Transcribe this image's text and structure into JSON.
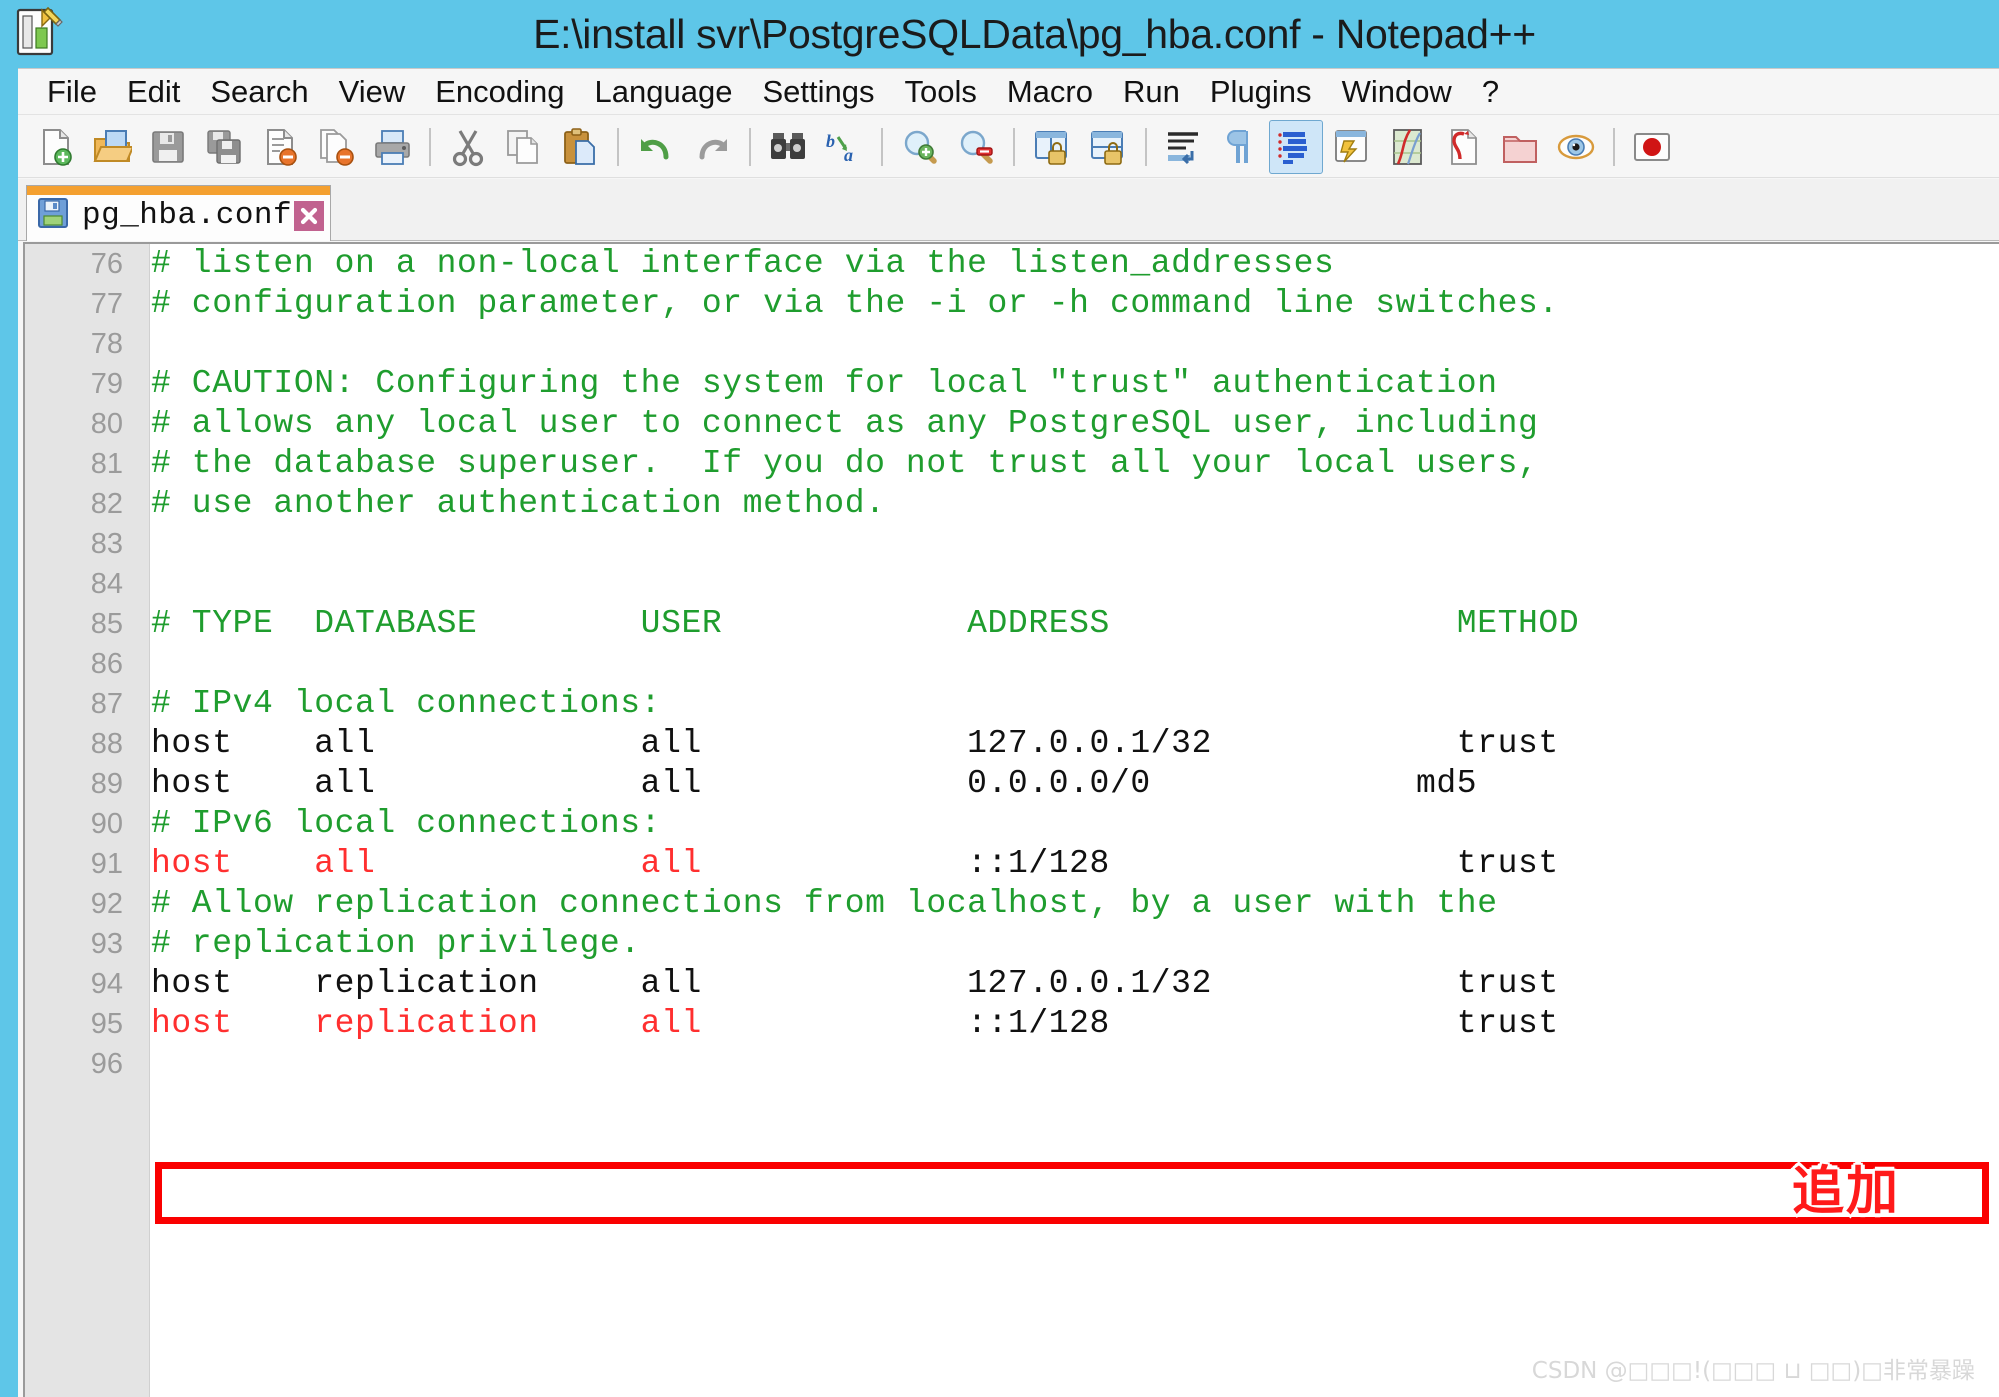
{
  "window": {
    "title": "E:\\install svr\\PostgreSQLData\\pg_hba.conf - Notepad++",
    "app_icon": "notepadpp-pencil-icon",
    "title_bar_color": "#5ec6e8"
  },
  "menubar": {
    "items": [
      {
        "label": "File",
        "name": "menu-file"
      },
      {
        "label": "Edit",
        "name": "menu-edit"
      },
      {
        "label": "Search",
        "name": "menu-search"
      },
      {
        "label": "View",
        "name": "menu-view"
      },
      {
        "label": "Encoding",
        "name": "menu-encoding"
      },
      {
        "label": "Language",
        "name": "menu-language"
      },
      {
        "label": "Settings",
        "name": "menu-settings"
      },
      {
        "label": "Tools",
        "name": "menu-tools"
      },
      {
        "label": "Macro",
        "name": "menu-macro"
      },
      {
        "label": "Run",
        "name": "menu-run"
      },
      {
        "label": "Plugins",
        "name": "menu-plugins"
      },
      {
        "label": "Window",
        "name": "menu-window"
      },
      {
        "label": "?",
        "name": "menu-help"
      }
    ]
  },
  "toolbar": {
    "icons": [
      "new-file-icon",
      "open-file-icon",
      "save-icon",
      "save-all-icon",
      "close-file-icon",
      "close-all-icon",
      "print-icon",
      "SEP",
      "cut-icon",
      "copy-icon",
      "paste-icon",
      "SEP",
      "undo-icon",
      "redo-icon",
      "SEP",
      "find-icon",
      "replace-icon",
      "SEP",
      "zoom-in-icon",
      "zoom-out-icon",
      "SEP",
      "sync-vertical-scroll-icon",
      "sync-horizontal-scroll-icon",
      "SEP",
      "word-wrap-icon",
      "show-all-characters-icon",
      "indent-guide-icon",
      "user-defined-language-icon",
      "document-map-icon",
      "function-list-icon",
      "folder-as-workspace-icon",
      "monitoring-icon",
      "SEP",
      "record-macro-icon"
    ],
    "active_icon": "indent-guide-icon"
  },
  "tabs": [
    {
      "label": "pg_hba.conf",
      "icon": "save-blue-icon",
      "close": "close-tab-icon",
      "active": true
    }
  ],
  "editor": {
    "first_line": 76,
    "lines": [
      {
        "n": 76,
        "segments": [
          {
            "t": "# listen on a non-local interface via the listen_addresses",
            "c": "comment"
          }
        ]
      },
      {
        "n": 77,
        "segments": [
          {
            "t": "# configuration parameter, or via the -i or -h command line switches.",
            "c": "comment"
          }
        ]
      },
      {
        "n": 78,
        "segments": [
          {
            "t": "",
            "c": "black"
          }
        ]
      },
      {
        "n": 79,
        "segments": [
          {
            "t": "# CAUTION: Configuring the system for local \"trust\" authentication",
            "c": "comment"
          }
        ]
      },
      {
        "n": 80,
        "segments": [
          {
            "t": "# allows any local user to connect as any PostgreSQL user, including",
            "c": "comment"
          }
        ]
      },
      {
        "n": 81,
        "segments": [
          {
            "t": "# the database superuser.  If you do not trust all your local users,",
            "c": "comment"
          }
        ]
      },
      {
        "n": 82,
        "segments": [
          {
            "t": "# use another authentication method.",
            "c": "comment"
          }
        ]
      },
      {
        "n": 83,
        "segments": [
          {
            "t": "",
            "c": "black"
          }
        ]
      },
      {
        "n": 84,
        "segments": [
          {
            "t": "",
            "c": "black"
          }
        ]
      },
      {
        "n": 85,
        "segments": [
          {
            "t": "# TYPE  DATABASE        USER            ADDRESS                 METHOD",
            "c": "comment"
          }
        ]
      },
      {
        "n": 86,
        "segments": [
          {
            "t": "",
            "c": "black"
          }
        ]
      },
      {
        "n": 87,
        "segments": [
          {
            "t": "# IPv4 local connections:",
            "c": "comment"
          }
        ]
      },
      {
        "n": 88,
        "segments": [
          {
            "t": "host    all             all             127.0.0.1/32            trust",
            "c": "black"
          }
        ]
      },
      {
        "n": 89,
        "segments": [
          {
            "t": "host    all             all             0.0.0.0/0             md5",
            "c": "black"
          }
        ]
      },
      {
        "n": 90,
        "segments": [
          {
            "t": "# IPv6 local connections:",
            "c": "comment"
          }
        ]
      },
      {
        "n": 91,
        "segments": [
          {
            "t": "host    all             all",
            "c": "red"
          },
          {
            "t": "             ::1/128                 trust",
            "c": "black"
          }
        ]
      },
      {
        "n": 92,
        "segments": [
          {
            "t": "# Allow replication connections from localhost, by a user with the",
            "c": "comment"
          }
        ]
      },
      {
        "n": 93,
        "segments": [
          {
            "t": "# replication privilege.",
            "c": "comment"
          }
        ]
      },
      {
        "n": 94,
        "segments": [
          {
            "t": "host    replication     all             127.0.0.1/32            trust",
            "c": "black"
          }
        ]
      },
      {
        "n": 95,
        "segments": [
          {
            "t": "host    replication     all",
            "c": "red"
          },
          {
            "t": "             ::1/128                 trust",
            "c": "black"
          }
        ]
      },
      {
        "n": 96,
        "segments": [
          {
            "t": "",
            "c": "black"
          }
        ]
      }
    ],
    "colors": {
      "comment": "#1f9d2e",
      "keyword_red": "#ff2f2f",
      "default_text": "#111111",
      "gutter_bg": "#e4e4e4",
      "gutter_text": "#9b9b9b",
      "background": "#ffffff"
    }
  },
  "annotation": {
    "label": "追加",
    "color": "#ff1a1a",
    "box_color": "#fa0000",
    "highlighted_line": 89
  },
  "watermark": {
    "text": "CSDN @□□□!(□□□ ⊔ □□)□非常暴躁"
  }
}
